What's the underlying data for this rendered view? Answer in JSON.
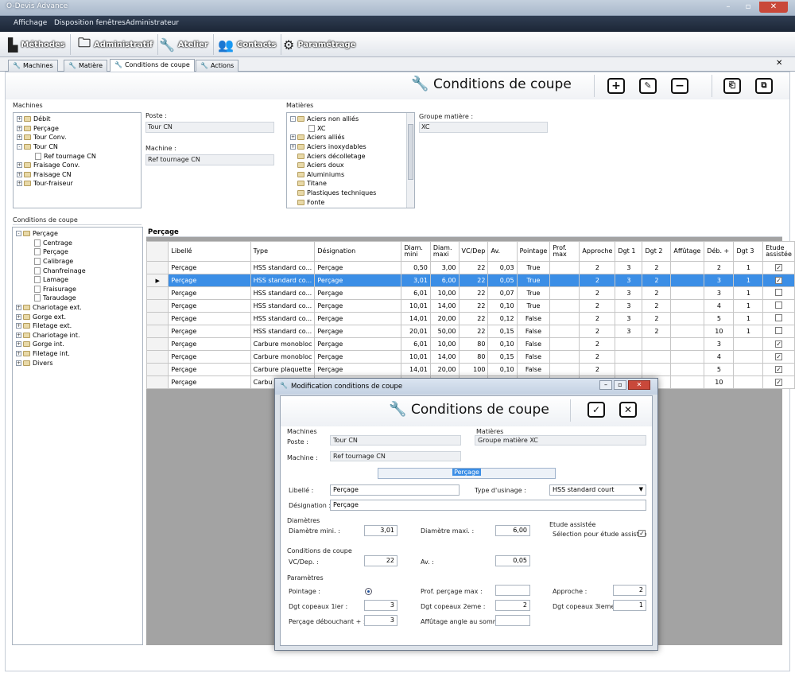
{
  "window": {
    "title": "O-Devis Advance"
  },
  "menu": [
    "Affichage",
    "Disposition fenêtres",
    "Administrateur"
  ],
  "ribbon": [
    {
      "label": "Méthodes",
      "icon": "methods-icon"
    },
    {
      "label": "Administratif",
      "icon": "folder-icon"
    },
    {
      "label": "Atelier",
      "icon": "wrench-icon"
    },
    {
      "label": "Contacts",
      "icon": "people-icon"
    },
    {
      "label": "Paramétrage",
      "icon": "gears-icon"
    }
  ],
  "tabs": [
    {
      "label": "Machines"
    },
    {
      "label": "Matière"
    },
    {
      "label": "Conditions de coupe"
    },
    {
      "label": "Actions"
    }
  ],
  "header": {
    "title": "Conditions de coupe"
  },
  "machines": {
    "label": "Machines",
    "tree": [
      {
        "label": "Débit",
        "level": 0,
        "expander": "+"
      },
      {
        "label": "Perçage",
        "level": 0,
        "expander": "+"
      },
      {
        "label": "Tour Conv.",
        "level": 0,
        "expander": "+"
      },
      {
        "label": "Tour CN",
        "level": 0,
        "expander": "-"
      },
      {
        "label": "Ref tournage CN",
        "level": 1,
        "expander": ""
      },
      {
        "label": "Fraisage Conv.",
        "level": 0,
        "expander": "+"
      },
      {
        "label": "Fraisage CN",
        "level": 0,
        "expander": "+"
      },
      {
        "label": "Tour-fraiseur",
        "level": 0,
        "expander": "+"
      }
    ],
    "poste_label": "Poste :",
    "poste_value": "Tour CN",
    "machine_label": "Machine :",
    "machine_value": "Ref tournage CN"
  },
  "matieres": {
    "label": "Matières",
    "tree": [
      {
        "label": "Aciers non alliés",
        "level": 0,
        "expander": "-"
      },
      {
        "label": "XC",
        "level": 1,
        "expander": ""
      },
      {
        "label": "Aciers alliés",
        "level": 0,
        "expander": "+"
      },
      {
        "label": "Aciers inoxydables",
        "level": 0,
        "expander": "+"
      },
      {
        "label": "Aciers décolletage",
        "level": 0,
        "expander": ""
      },
      {
        "label": "Aciers doux",
        "level": 0,
        "expander": ""
      },
      {
        "label": "Aluminiums",
        "level": 0,
        "expander": ""
      },
      {
        "label": "Titane",
        "level": 0,
        "expander": ""
      },
      {
        "label": "Plastiques techniques",
        "level": 0,
        "expander": ""
      },
      {
        "label": "Fonte",
        "level": 0,
        "expander": ""
      }
    ],
    "groupe_label": "Groupe matière :",
    "groupe_value": "XC"
  },
  "conditions": {
    "label": "Conditions de coupe",
    "tree": [
      {
        "label": "Perçage",
        "level": 0,
        "expander": "-"
      },
      {
        "label": "Centrage",
        "level": 1,
        "expander": ""
      },
      {
        "label": "Perçage",
        "level": 1,
        "expander": ""
      },
      {
        "label": "Calibrage",
        "level": 1,
        "expander": ""
      },
      {
        "label": "Chanfreinage",
        "level": 1,
        "expander": ""
      },
      {
        "label": "Lamage",
        "level": 1,
        "expander": ""
      },
      {
        "label": "Fraisurage",
        "level": 1,
        "expander": ""
      },
      {
        "label": "Taraudage",
        "level": 1,
        "expander": ""
      },
      {
        "label": "Chariotage ext.",
        "level": 0,
        "expander": "+"
      },
      {
        "label": "Gorge ext.",
        "level": 0,
        "expander": "+"
      },
      {
        "label": "Filetage ext.",
        "level": 0,
        "expander": "+"
      },
      {
        "label": "Chariotage int.",
        "level": 0,
        "expander": "+"
      },
      {
        "label": "Gorge int.",
        "level": 0,
        "expander": "+"
      },
      {
        "label": "Filetage int.",
        "level": 0,
        "expander": "+"
      },
      {
        "label": "Divers",
        "level": 0,
        "expander": "+"
      }
    ]
  },
  "grid": {
    "title": "Perçage",
    "columns": [
      "Libellé",
      "Type",
      "Désignation",
      "Diam. mini",
      "Diam. maxi",
      "VC/Dep",
      "Av.",
      "Pointage",
      "Prof. max",
      "Approche",
      "Dgt 1",
      "Dgt 2",
      "Affûtage",
      "Déb. +",
      "Dgt 3",
      "Etude assistée"
    ],
    "rows": [
      [
        "Perçage",
        "HSS standard co...",
        "Perçage",
        "0,50",
        "3,00",
        "22",
        "0,03",
        "True",
        "",
        "2",
        "3",
        "2",
        "",
        "2",
        "1",
        "x"
      ],
      [
        "Perçage",
        "HSS standard co...",
        "Perçage",
        "3,01",
        "6,00",
        "22",
        "0,05",
        "True",
        "",
        "2",
        "3",
        "2",
        "",
        "3",
        "1",
        "x"
      ],
      [
        "Perçage",
        "HSS standard co...",
        "Perçage",
        "6,01",
        "10,00",
        "22",
        "0,07",
        "True",
        "",
        "2",
        "3",
        "2",
        "",
        "3",
        "1",
        ""
      ],
      [
        "Perçage",
        "HSS standard co...",
        "Perçage",
        "10,01",
        "14,00",
        "22",
        "0,10",
        "True",
        "",
        "2",
        "3",
        "2",
        "",
        "4",
        "1",
        ""
      ],
      [
        "Perçage",
        "HSS standard co...",
        "Perçage",
        "14,01",
        "20,00",
        "22",
        "0,12",
        "False",
        "",
        "2",
        "3",
        "2",
        "",
        "5",
        "1",
        ""
      ],
      [
        "Perçage",
        "HSS standard co...",
        "Perçage",
        "20,01",
        "50,00",
        "22",
        "0,15",
        "False",
        "",
        "2",
        "3",
        "2",
        "",
        "10",
        "1",
        ""
      ],
      [
        "Perçage",
        "Carbure monobloc",
        "Perçage",
        "6,01",
        "10,00",
        "80",
        "0,10",
        "False",
        "",
        "2",
        "",
        "",
        "",
        "3",
        "",
        "x"
      ],
      [
        "Perçage",
        "Carbure monobloc",
        "Perçage",
        "10,01",
        "14,00",
        "80",
        "0,15",
        "False",
        "",
        "2",
        "",
        "",
        "",
        "4",
        "",
        "x"
      ],
      [
        "Perçage",
        "Carbure plaquette",
        "Perçage",
        "14,01",
        "20,00",
        "100",
        "0,10",
        "False",
        "",
        "2",
        "",
        "",
        "",
        "5",
        "",
        "x"
      ],
      [
        "Perçage",
        "Carbu",
        "",
        "",
        "",
        "",
        "",
        "",
        "",
        "",
        "",
        "",
        "",
        "10",
        "",
        "x"
      ]
    ],
    "selected_row": 1
  },
  "dialog": {
    "title": "Modification conditions de coupe",
    "header": "Conditions de coupe",
    "machines_label": "Machines",
    "poste_label": "Poste :",
    "poste_value": "Tour CN",
    "machine_label": "Machine :",
    "machine_value": "Ref tournage CN",
    "matieres_label": "Matières",
    "groupe_value": "Groupe matière XC",
    "selected_title": "Perçage",
    "libelle_label": "Libellé :",
    "libelle_value": "Perçage",
    "type_label": "Type d'usinage :",
    "type_value": "HSS standard court",
    "designation_label": "Désignation :",
    "designation_value": "Perçage",
    "diametres_label": "Diamètres",
    "diam_min_label": "Diamètre mini. :",
    "diam_min_value": "3,01",
    "diam_max_label": "Diamètre maxi. :",
    "diam_max_value": "6,00",
    "etude_label": "Etude assistée",
    "etude_check_label": "Sélection pour étude assistée",
    "etude_checked": true,
    "conditions_label": "Conditions de coupe",
    "vc_label": "VC/Dep. :",
    "vc_value": "22",
    "av_label": "Av. :",
    "av_value": "0,05",
    "parametres_label": "Paramètres",
    "pointage_label": "Pointage :",
    "prof_label": "Prof. perçage max :",
    "prof_value": "",
    "approche_label": "Approche :",
    "approche_value": "2",
    "dgt1_label": "Dgt copeaux 1ier :",
    "dgt1_value": "3",
    "dgt2_label": "Dgt copeaux 2eme :",
    "dgt2_value": "2",
    "dgt3_label": "Dgt copeaux 3ieme :",
    "dgt3_value": "1",
    "deb_label": "Perçage débouchant + :",
    "deb_value": "3",
    "aff_label": "Affûtage angle au sommet :",
    "aff_value": ""
  }
}
